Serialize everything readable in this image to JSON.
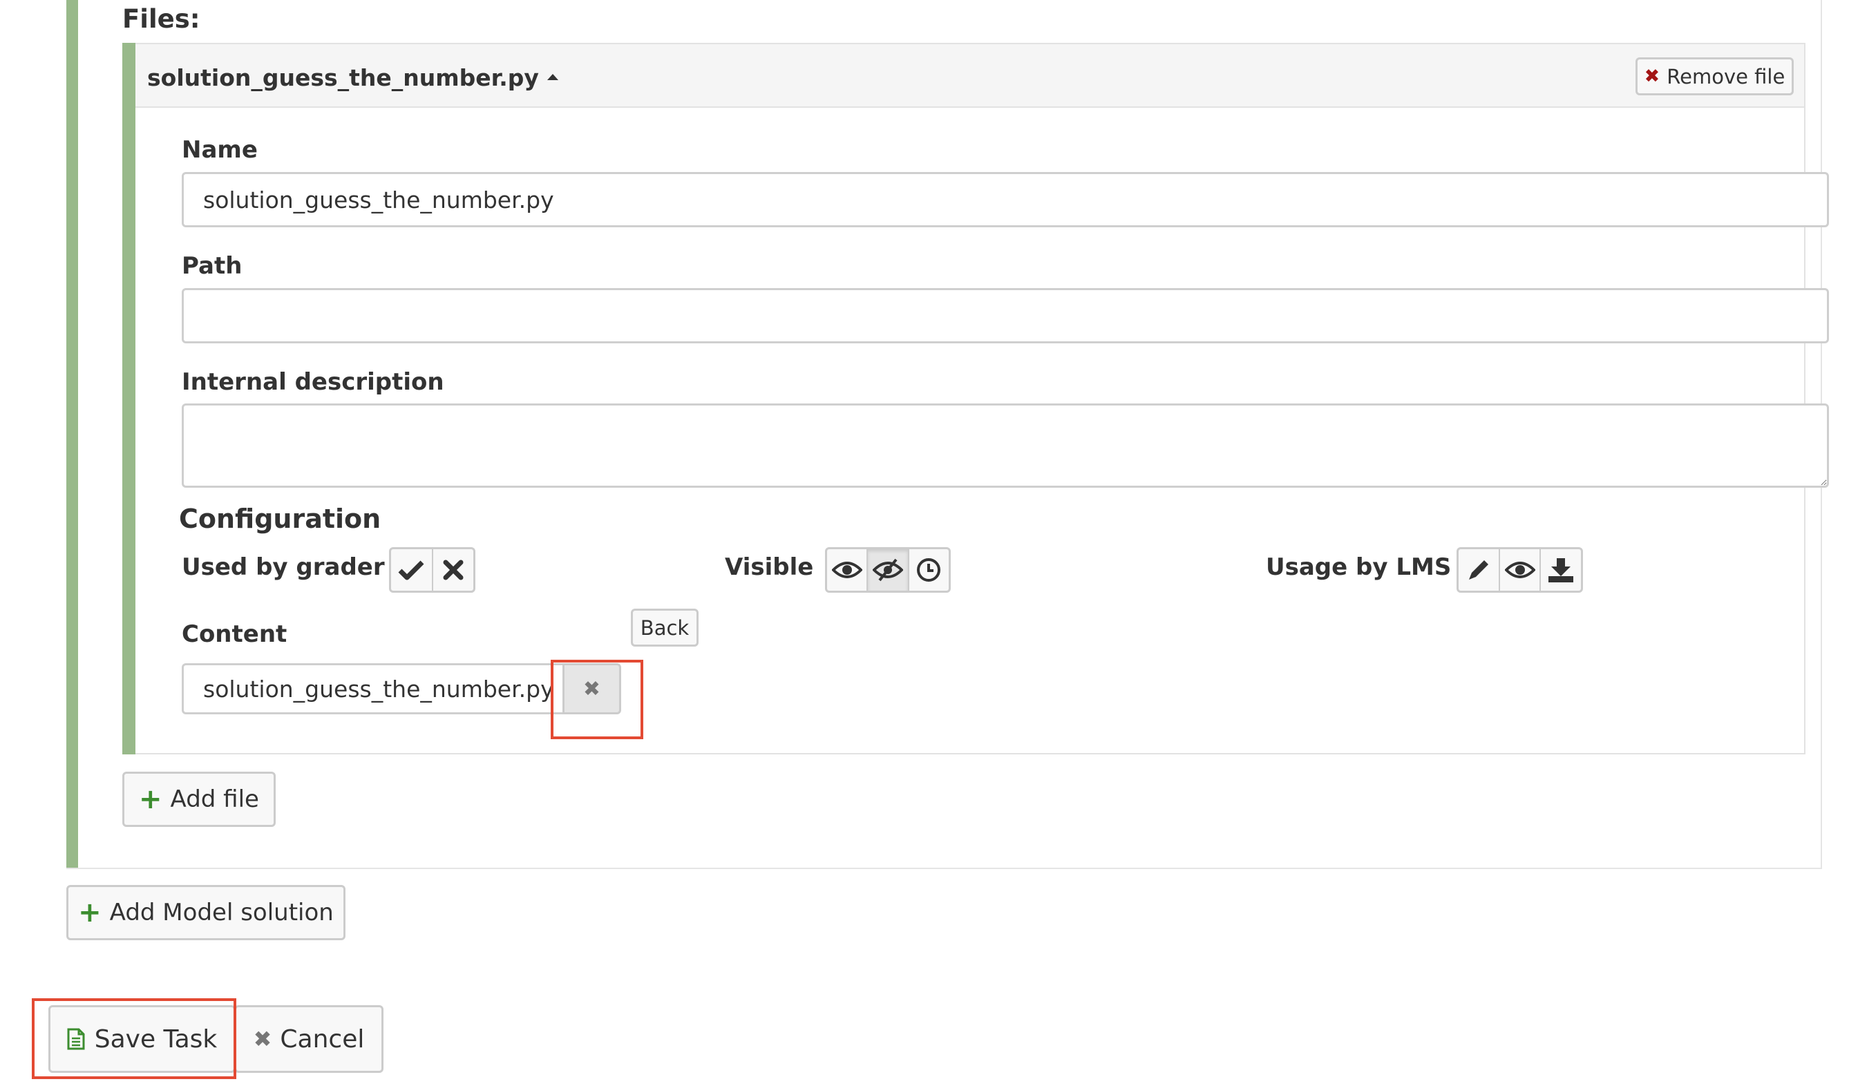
{
  "files_heading": "Files:",
  "file": {
    "title": "solution_guess_the_number.py",
    "remove_label": "Remove file",
    "name_label": "Name",
    "name_value": "solution_guess_the_number.py",
    "path_label": "Path",
    "path_value": "",
    "description_label": "Internal description",
    "description_value": ""
  },
  "configuration": {
    "heading": "Configuration",
    "used_by_grader_label": "Used by grader",
    "used_by_grader_options": [
      "checkmark-icon",
      "cross-icon"
    ],
    "visible_label": "Visible",
    "visible_options": [
      "eye-icon",
      "eye-slash-icon",
      "clock-icon"
    ],
    "visible_selected": "eye-slash-icon",
    "usage_by_lms_label": "Usage by LMS",
    "usage_by_lms_options": [
      "pencil-icon",
      "eye-icon",
      "download-icon"
    ]
  },
  "content": {
    "label": "Content",
    "back_label": "Back",
    "attached_file": "solution_guess_the_number.py",
    "clear_icon": "close-icon"
  },
  "actions": {
    "add_file_label": "Add file",
    "add_model_solution_label": "Add Model solution",
    "save_task_label": "Save Task",
    "cancel_label": "Cancel"
  },
  "colors": {
    "panel_accent": "#98b98a",
    "highlight": "#e34a33",
    "add_icon": "#3c8d2f",
    "remove_icon": "#a31515"
  }
}
